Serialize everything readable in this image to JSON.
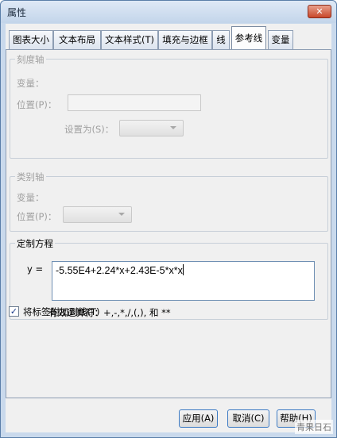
{
  "window": {
    "title": "属性",
    "close_glyph": "✕"
  },
  "tabs": [
    {
      "label": "图表大小"
    },
    {
      "label": "文本布局"
    },
    {
      "label": "文本样式(T)"
    },
    {
      "label": "填充与边框"
    },
    {
      "label": "线"
    },
    {
      "label": "参考线",
      "active": true
    },
    {
      "label": "变量"
    }
  ],
  "scale_axis": {
    "legend": "刻度轴",
    "variable_label": "变量：",
    "position_label": "位置(P)：",
    "position_value": "",
    "set_to_label": "设置为(S)：",
    "set_to_value": ""
  },
  "category_axis": {
    "legend": "类别轴",
    "variable_label": "变量：",
    "position_label": "位置(P)：",
    "position_value": ""
  },
  "custom_equation": {
    "legend": "定制方程",
    "y_label": "y =",
    "equation": "-5.55E4+2.24*x+2.43E-5*x*x",
    "operators_note": "有效运算符：+,-,*,/,(,), 和 **"
  },
  "attach_label": {
    "checked": true,
    "label": "将标签附加到线(T)"
  },
  "buttons": {
    "apply": "应用(A)",
    "cancel": "取消(C)",
    "help": "帮助(H)"
  },
  "watermark": "青果日石",
  "colors": {
    "title_bar": "#c9d9ec",
    "button_border": "#3d7bc4",
    "active_tab": "#fdfdfd"
  }
}
